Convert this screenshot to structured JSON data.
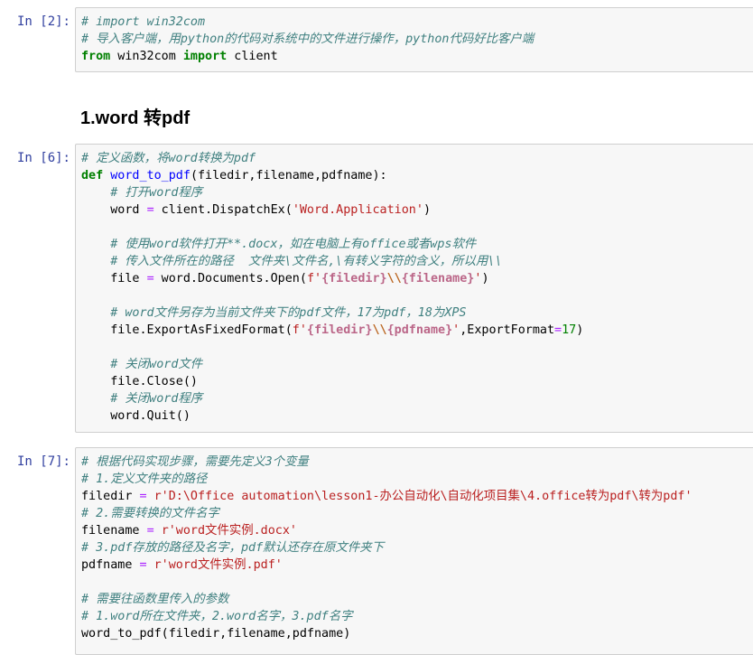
{
  "cells": [
    {
      "prompt": "In  [2]:",
      "lines": [
        [
          [
            "c",
            "# import win32com"
          ]
        ],
        [
          [
            "c",
            "# 导入客户端，用python的代码对系统中的文件进行操作，python代码好比客户端"
          ]
        ],
        [
          [
            "k",
            "from"
          ],
          [
            "t",
            " win32com "
          ],
          [
            "k",
            "import"
          ],
          [
            "t",
            " client"
          ]
        ]
      ]
    },
    {
      "prompt": "In  [6]:",
      "lines": [
        [
          [
            "c",
            "# 定义函数，将word转换为pdf"
          ]
        ],
        [
          [
            "k",
            "def"
          ],
          [
            "t",
            " "
          ],
          [
            "f",
            "word_to_pdf"
          ],
          [
            "t",
            "(filedir,filename,pdfname):"
          ]
        ],
        [
          [
            "t",
            "    "
          ],
          [
            "c",
            "# 打开word程序"
          ]
        ],
        [
          [
            "t",
            "    word "
          ],
          [
            "o",
            "="
          ],
          [
            "t",
            " client.DispatchEx("
          ],
          [
            "s",
            "'Word.Application'"
          ],
          [
            "t",
            ")"
          ]
        ],
        [],
        [
          [
            "t",
            "    "
          ],
          [
            "c",
            "# 使用word软件打开**.docx，如在电脑上有office或者wps软件"
          ]
        ],
        [
          [
            "t",
            "    "
          ],
          [
            "c",
            "# 传入文件所在的路径  文件夹\\文件名,\\有转义字符的含义，所以用\\\\"
          ]
        ],
        [
          [
            "t",
            "    file "
          ],
          [
            "o",
            "="
          ],
          [
            "t",
            " word.Documents.Open("
          ],
          [
            "s",
            "f'"
          ],
          [
            "si",
            "{filedir}"
          ],
          [
            "se",
            "\\\\"
          ],
          [
            "si",
            "{filename}"
          ],
          [
            "s",
            "'"
          ],
          [
            "t",
            ")"
          ]
        ],
        [],
        [
          [
            "t",
            "    "
          ],
          [
            "c",
            "# word文件另存为当前文件夹下的pdf文件，17为pdf，18为XPS"
          ]
        ],
        [
          [
            "t",
            "    file.ExportAsFixedFormat("
          ],
          [
            "s",
            "f'"
          ],
          [
            "si",
            "{filedir}"
          ],
          [
            "se",
            "\\\\"
          ],
          [
            "si",
            "{pdfname}"
          ],
          [
            "s",
            "'"
          ],
          [
            "t",
            ",ExportFormat"
          ],
          [
            "o",
            "="
          ],
          [
            "n",
            "17"
          ],
          [
            "t",
            ")"
          ]
        ],
        [],
        [
          [
            "t",
            "    "
          ],
          [
            "c",
            "# 关闭word文件"
          ]
        ],
        [
          [
            "t",
            "    file.Close()"
          ]
        ],
        [
          [
            "t",
            "    "
          ],
          [
            "c",
            "# 关闭word程序"
          ]
        ],
        [
          [
            "t",
            "    word.Quit()"
          ]
        ]
      ]
    },
    {
      "prompt": "In  [7]:",
      "lines": [
        [
          [
            "c",
            "# 根据代码实现步骤，需要先定义3个变量"
          ]
        ],
        [
          [
            "c",
            "# 1.定义文件夹的路径"
          ]
        ],
        [
          [
            "t",
            "filedir "
          ],
          [
            "o",
            "="
          ],
          [
            "t",
            " "
          ],
          [
            "s",
            "r'D:\\Office automation\\lesson1-办公自动化\\自动化项目集\\4.office转为pdf\\转为pdf'"
          ]
        ],
        [
          [
            "c",
            "# 2.需要转换的文件名字"
          ]
        ],
        [
          [
            "t",
            "filename "
          ],
          [
            "o",
            "="
          ],
          [
            "t",
            " "
          ],
          [
            "s",
            "r'word文件实例.docx'"
          ]
        ],
        [
          [
            "c",
            "# 3.pdf存放的路径及名字，pdf默认还存在原文件夹下"
          ]
        ],
        [
          [
            "t",
            "pdfname "
          ],
          [
            "o",
            "="
          ],
          [
            "t",
            " "
          ],
          [
            "s",
            "r'word文件实例.pdf'"
          ]
        ],
        [],
        [
          [
            "c",
            "# 需要往函数里传入的参数"
          ]
        ],
        [
          [
            "c",
            "# 1.word所在文件夹，2.word名字，3.pdf名字"
          ]
        ],
        [
          [
            "t",
            "word_to_pdf(filedir,filename,pdfname)"
          ]
        ]
      ]
    }
  ],
  "markdown": {
    "heading": "1.word 转pdf"
  }
}
